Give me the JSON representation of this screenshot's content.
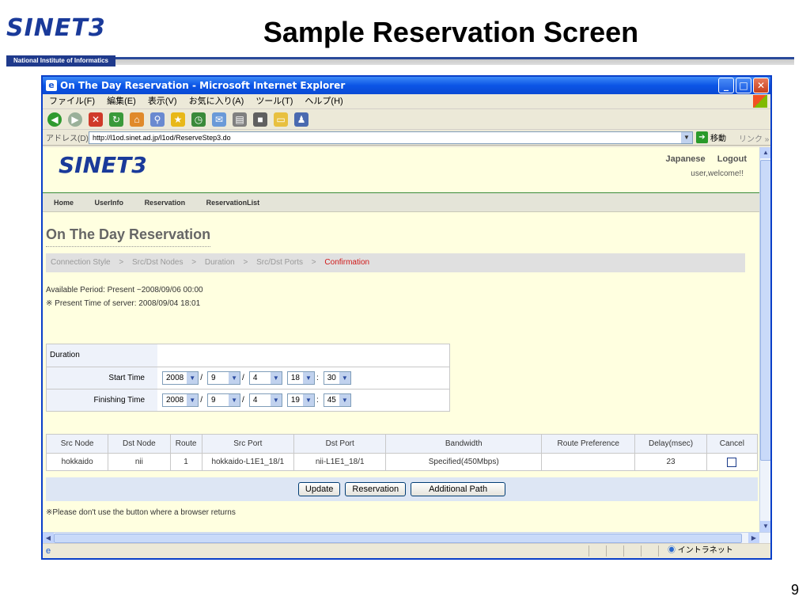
{
  "slide": {
    "logo_text": "SINET3",
    "logo_subtitle": "National Institute of Informatics",
    "title": "Sample Reservation Screen",
    "page_number": "9"
  },
  "window": {
    "title": "On The Day Reservation - Microsoft Internet Explorer",
    "menu": [
      "ファイル(F)",
      "編集(E)",
      "表示(V)",
      "お気に入り(A)",
      "ツール(T)",
      "ヘルプ(H)"
    ],
    "address_label": "アドレス(D)",
    "url": "http://l1od.sinet.ad.jp/l1od/ReserveStep3.do",
    "go_label": "移動",
    "links_label": "リンク",
    "status_zone": "イントラネット"
  },
  "site": {
    "logo_text": "SINET3",
    "lang": [
      "Japanese",
      "Logout"
    ],
    "welcome": "user,welcome!!",
    "nav": [
      "Home",
      "UserInfo",
      "Reservation",
      "ReservationList"
    ]
  },
  "page": {
    "heading": "On The Day Reservation",
    "steps": [
      "Connection Style",
      "Src/Dst Nodes",
      "Duration",
      "Src/Dst Ports",
      "Confirmation"
    ],
    "step_separator": ">",
    "available_period": "Available Period: Present ~2008/09/06 00:00",
    "present_time": "※ Present Time of server: 2008/09/04 18:01"
  },
  "duration": {
    "header": "Duration",
    "start_label": "Start Time",
    "finish_label": "Finishing Time",
    "start": {
      "year": "2008",
      "month": "9",
      "day": "4",
      "hour": "18",
      "minute": "30"
    },
    "finish": {
      "year": "2008",
      "month": "9",
      "day": "4",
      "hour": "19",
      "minute": "45"
    }
  },
  "reservation_table": {
    "headers": [
      "Src Node",
      "Dst Node",
      "Route",
      "Src Port",
      "Dst Port",
      "Bandwidth",
      "Route Preference",
      "Delay(msec)",
      "Cancel"
    ],
    "rows": [
      {
        "src": "hokkaido",
        "dst": "nii",
        "route": "1",
        "src_port": "hokkaido-L1E1_18/1",
        "dst_port": "nii-L1E1_18/1",
        "bandwidth": "Specified(450Mbps)",
        "route_pref": "",
        "delay": "23"
      }
    ]
  },
  "buttons": {
    "update": "Update",
    "reservation": "Reservation",
    "additional": "Additional Path"
  },
  "note": "※Please don't use the button where a browser returns"
}
